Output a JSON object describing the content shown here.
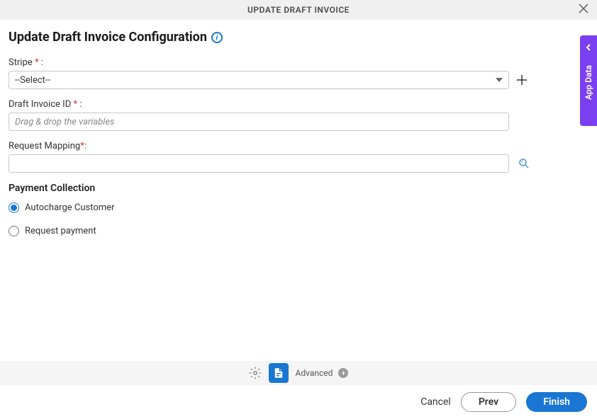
{
  "header": {
    "title": "UPDATE DRAFT INVOICE"
  },
  "page": {
    "title": "Update Draft Invoice Configuration"
  },
  "fields": {
    "stripe": {
      "label": "Stripe",
      "colon": ":",
      "selected": "--Select--"
    },
    "draft_invoice_id": {
      "label": "Draft Invoice ID",
      "colon": ":",
      "placeholder": "Drag & drop the variables"
    },
    "request_mapping": {
      "label": "Request Mapping",
      "colon": ":"
    }
  },
  "payment_collection": {
    "title": "Payment Collection",
    "options": {
      "autocharge": "Autocharge Customer",
      "request": "Request payment"
    }
  },
  "toolbar": {
    "advanced_label": "Advanced"
  },
  "footer": {
    "cancel": "Cancel",
    "prev": "Prev",
    "finish": "Finish"
  },
  "side_tab": {
    "label": "App Data"
  }
}
